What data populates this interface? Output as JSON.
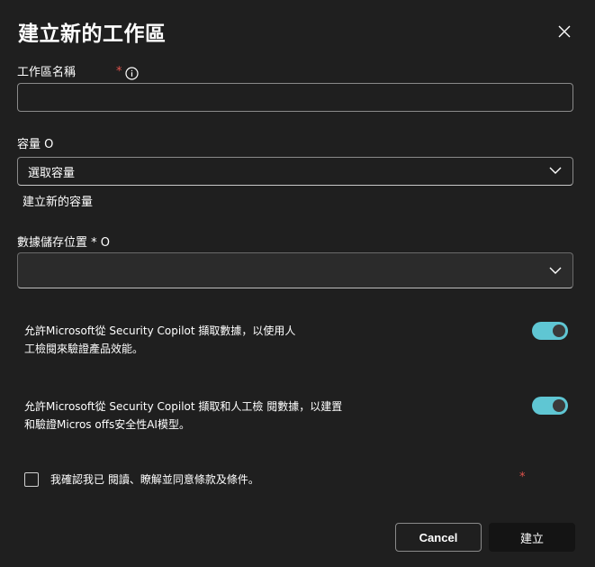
{
  "dialog": {
    "title": "建立新的工作區",
    "workspace_name": {
      "label": "工作區名稱",
      "required_mark": "*",
      "value": "",
      "placeholder": ""
    },
    "capacity": {
      "label": "容量 O",
      "selected": "選取容量",
      "create_link": "建立新的容量"
    },
    "data_storage": {
      "label": "數據儲存位置 * O",
      "selected": ""
    },
    "toggle1": {
      "text": "允許Microsoft從 Security Copilot 擷取數據，以使用人工檢閱來驗證產品效能。",
      "on": true
    },
    "toggle2": {
      "text": "允許Microsoft從 Security Copilot 擷取和人工檢 閱數據，以建置和驗證Micros offs安全性AI模型。",
      "on": true
    },
    "terms": {
      "label": "我確認我已 閱讀、瞭解並同意條款及條件。",
      "required_mark": "*",
      "checked": false
    },
    "buttons": {
      "cancel": "Cancel",
      "create": "建立"
    }
  },
  "colors": {
    "background": "#1f1f1f",
    "toggle_on": "#5fc6d3",
    "required": "#e0534c",
    "primary_button": "#141414"
  },
  "icons": {
    "close": "close-icon",
    "info": "info-icon",
    "chevron": "chevron-down-icon"
  }
}
